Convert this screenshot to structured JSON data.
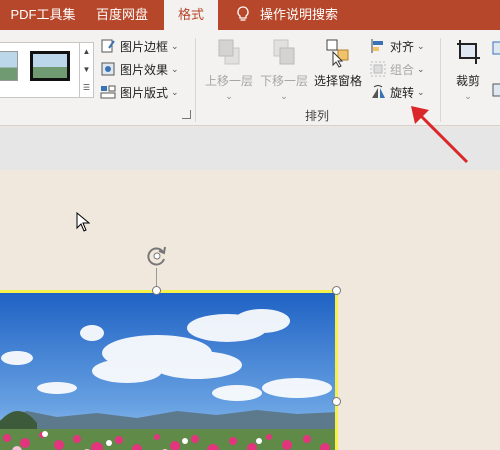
{
  "tabs": [
    {
      "label": "PDF工具集",
      "active": false
    },
    {
      "label": "百度网盘",
      "active": false
    },
    {
      "label": "格式",
      "active": true
    }
  ],
  "search": {
    "label": "操作说明搜索",
    "icon": "lightbulb-icon"
  },
  "picture_styles": {
    "border_label": "图片边框",
    "effects_label": "图片效果",
    "layout_label": "图片版式"
  },
  "arrange": {
    "bring_forward_label": "上移一层",
    "send_backward_label": "下移一层",
    "selection_pane_label": "选择窗格",
    "align_label": "对齐",
    "group_label": "组合",
    "rotate_label": "旋转",
    "group_title": "排列"
  },
  "size": {
    "crop_label": "裁剪"
  },
  "colors": {
    "accent": "#b7472a",
    "selection_border": "#f5f04a",
    "annotation_arrow": "#d9272a"
  }
}
